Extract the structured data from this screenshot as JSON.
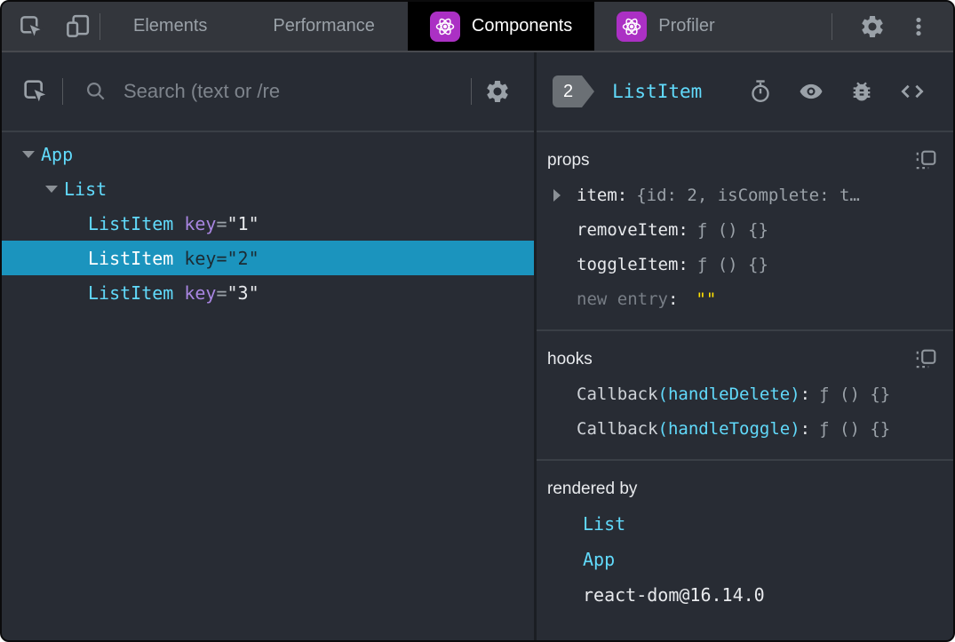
{
  "colors": {
    "accent_cyan": "#61dafb",
    "selection_blue": "#1b94be",
    "react_icon_purple": "#ab30c4",
    "new_entry_yellow": "#ffe102",
    "active_tab_bg": "#000000",
    "panel_bg": "#282c34"
  },
  "tabbar": {
    "tabs": [
      {
        "label": "Elements",
        "active": false
      },
      {
        "label": "Performance",
        "active": false
      },
      {
        "label": "Components",
        "active": true
      },
      {
        "label": "Profiler",
        "active": false
      }
    ],
    "icons": [
      "inspect-element-icon",
      "toggle-device-toolbar-icon",
      "settings-gear-icon",
      "more-options-kebab-icon"
    ]
  },
  "left": {
    "search": {
      "placeholder": "Search (text or /re"
    },
    "icons": [
      "inspect-element-icon",
      "search-magnifier-icon",
      "settings-gear-icon"
    ],
    "tree": [
      {
        "label": "App",
        "expanded": true
      },
      {
        "label": "List",
        "expanded": true
      },
      {
        "label": "ListItem",
        "attr": "key",
        "eq": "=",
        "value": "\"1\"",
        "selected": false
      },
      {
        "label": "ListItem",
        "attr": "key",
        "eq": "=",
        "value": "\"2\"",
        "selected": true
      },
      {
        "label": "ListItem",
        "attr": "key",
        "eq": "=",
        "value": "\"3\"",
        "selected": false
      }
    ]
  },
  "right": {
    "header": {
      "badge": "2",
      "title": "ListItem",
      "icons": [
        "suspend-timer-icon",
        "inspect-eye-icon",
        "log-bug-icon",
        "view-source-icon"
      ]
    },
    "props": {
      "title": "props",
      "rows": [
        {
          "name": "item",
          "sep": ":",
          "value": "{id: 2, isComplete: t…",
          "expandable": true
        },
        {
          "name": "removeItem",
          "sep": ":",
          "value": "ƒ () {}",
          "expandable": false
        },
        {
          "name": "toggleItem",
          "sep": ":",
          "value": "ƒ () {}",
          "expandable": false
        }
      ],
      "new_entry": {
        "name": "new entry",
        "sep": ":",
        "value": "\"\""
      }
    },
    "hooks": {
      "title": "hooks",
      "rows": [
        {
          "name": "Callback",
          "detail": "(handleDelete)",
          "sep": ":",
          "value": "ƒ () {}"
        },
        {
          "name": "Callback",
          "detail": "(handleToggle)",
          "sep": ":",
          "value": "ƒ () {}"
        }
      ]
    },
    "rendered_by": {
      "title": "rendered by",
      "items": [
        {
          "label": "List",
          "link": true
        },
        {
          "label": "App",
          "link": true
        },
        {
          "label": "react-dom@16.14.0",
          "link": false
        }
      ]
    }
  }
}
